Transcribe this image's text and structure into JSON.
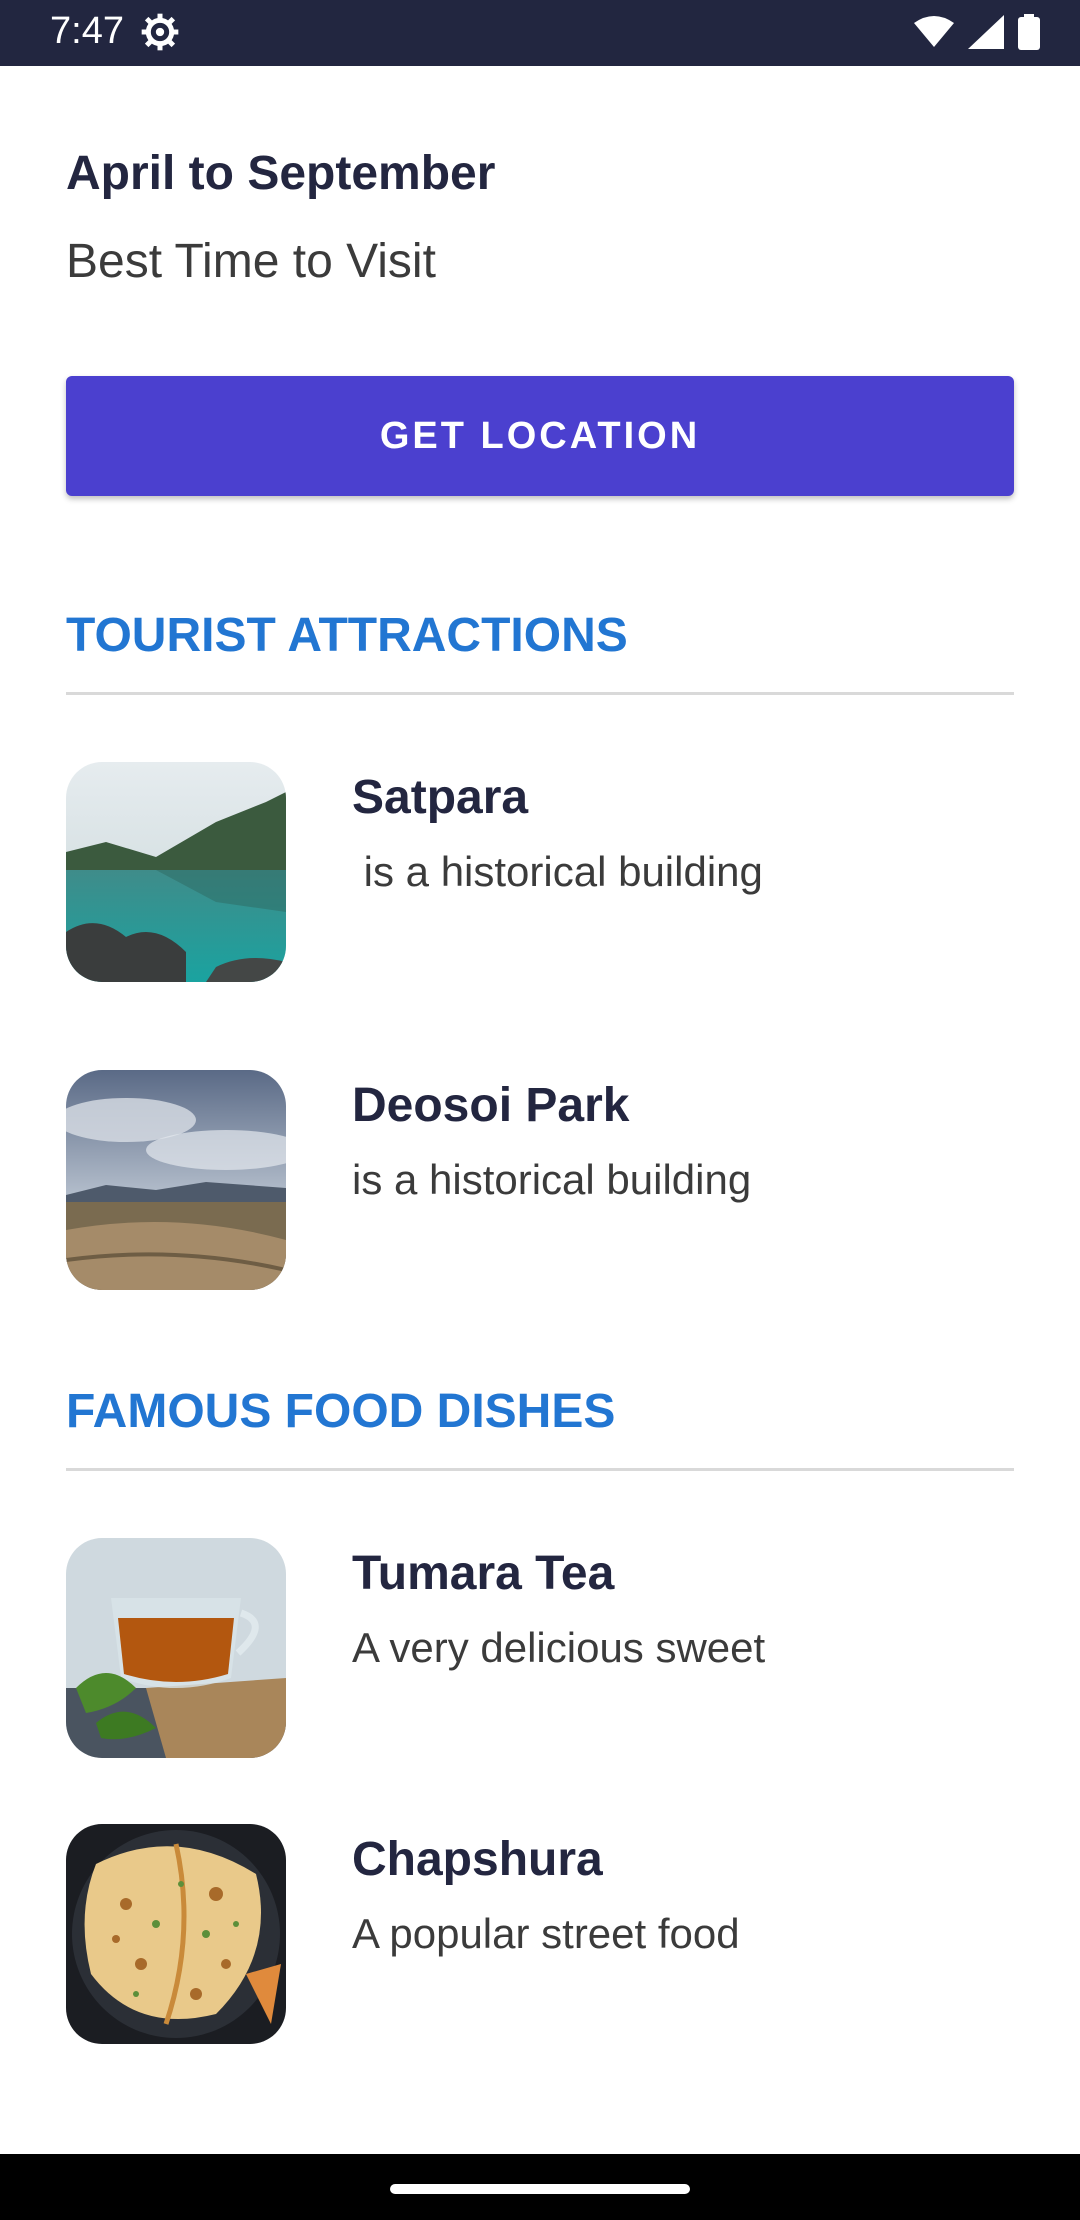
{
  "status_bar": {
    "time": "7:47",
    "icons": [
      "settings-gear-icon",
      "wifi-icon",
      "signal-icon",
      "battery-icon"
    ]
  },
  "best_time": {
    "months": "April to September",
    "label": "Best Time to Visit"
  },
  "get_location_button": {
    "label": "GET LOCATION",
    "color": "#4b40cf"
  },
  "sections": {
    "attractions": {
      "title": "TOURIST ATTRACTIONS",
      "items": [
        {
          "title": "Satpara",
          "subtitle": " is a historical building",
          "image": "lake-mountain-image"
        },
        {
          "title": "Deosoi Park",
          "subtitle": "is a historical building",
          "image": "plains-road-image"
        }
      ]
    },
    "food": {
      "title": "FAMOUS FOOD DISHES",
      "items": [
        {
          "title": "Tumara Tea",
          "subtitle": "A very delicious sweet",
          "image": "tea-cup-image"
        },
        {
          "title": "Chapshura",
          "subtitle": "A popular street food",
          "image": "flatbread-image"
        }
      ]
    }
  },
  "colors": {
    "accent_blue": "#2276d2",
    "status_bar": "#222640",
    "heading_text": "#232640"
  }
}
